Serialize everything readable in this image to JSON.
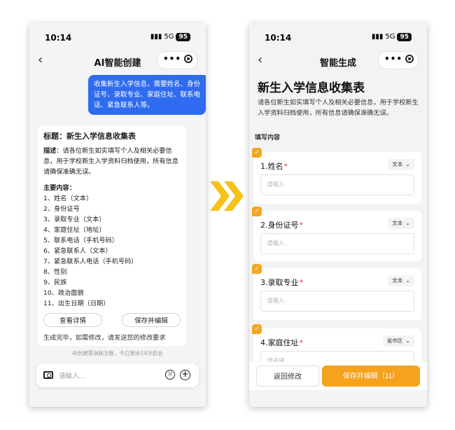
{
  "left": {
    "status": {
      "time": "10:14",
      "network": "5G",
      "battery": "95"
    },
    "nav": {
      "title": "AI智能创建"
    },
    "user_message": "收集新生入学信息，需要姓名、身份证号、录取专业、家庭住址、联系电话、紧急联系人等。",
    "reply": {
      "title": "标题：新生入学信息收集表",
      "desc_label": "描述",
      "desc_text": "：请各位新生如实填写个人及相关必要信息，用于学校新生入学资料归档使用，所有信息请确保准确无误。",
      "main_label": "主要内容：",
      "items": [
        "1、姓名（文本）",
        "2、身份证号",
        "3、录取专业（文本）",
        "4、家庭住址（地址）",
        "5、联系电话（手机号码）",
        "6、紧急联系人（文本）",
        "7、紧急联系人电话（手机号码）",
        "8、性别",
        "9、民族",
        "10、政治面貌",
        "11、出生日期（日期）"
      ],
      "btn_details": "查看详情",
      "btn_save_edit": "保存并编辑",
      "footer": "生成完毕，如需修改，请发送您的修改要求"
    },
    "quota": "AI创建需消耗次数，今日剩余19次机会",
    "input_placeholder": "请输入..."
  },
  "right": {
    "status": {
      "time": "10:14",
      "network": "5G",
      "battery": "95"
    },
    "nav": {
      "title": "智能生成"
    },
    "form_title": "新生入学信息收集表",
    "form_desc": "请各位新生如实填写个人及相关必要信息，用于学校新生入学资料归档使用，所有信息请确保准确无误。",
    "section_label": "填写内容",
    "fields": [
      {
        "label": "1.姓名",
        "type": "文本",
        "placeholder": "请输入"
      },
      {
        "label": "2.身份证号",
        "type": "文本",
        "placeholder": "请输入"
      },
      {
        "label": "3.录取专业",
        "type": "文本",
        "placeholder": "请输入"
      },
      {
        "label": "4.家庭住址",
        "type": "省市区",
        "placeholder": "请选择"
      }
    ],
    "required_mark": "*",
    "btn_back": "返回修改",
    "btn_save": "保存并编辑（11）"
  },
  "colors": {
    "user_bubble": "#2f6bf0",
    "accent_orange": "#f5a21c",
    "arrow_yellow": "#f6c21a"
  }
}
